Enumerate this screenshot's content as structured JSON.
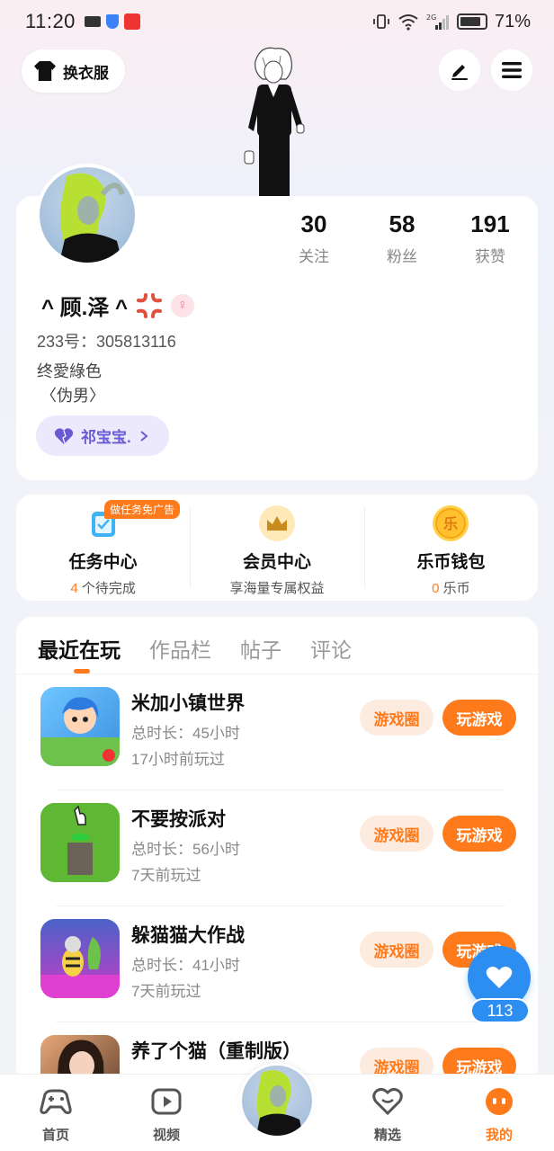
{
  "status_bar": {
    "time": "11:20",
    "battery": "71%",
    "network": "2G"
  },
  "top": {
    "outfit_label": "换衣服"
  },
  "profile": {
    "stats": [
      {
        "value": "30",
        "label": "关注"
      },
      {
        "value": "58",
        "label": "粉丝"
      },
      {
        "value": "191",
        "label": "获赞"
      }
    ],
    "username": "^ 顾.泽 ^",
    "uid": "233号：305813116",
    "bio_line1": "终愛綠色",
    "bio_line2": "〈伪男〉",
    "partner": "祁宝宝."
  },
  "services": [
    {
      "title": "任务中心",
      "count": "4",
      "sub": " 个待完成",
      "badge": "做任务免广告"
    },
    {
      "title": "会员中心",
      "sub": "享海量专属权益"
    },
    {
      "title": "乐币钱包",
      "count": "0",
      "sub": " 乐币"
    }
  ],
  "tabs": [
    "最近在玩",
    "作品栏",
    "帖子",
    "评论"
  ],
  "games": [
    {
      "name": "米加小镇世界",
      "duration": "总时长：45小时",
      "last": "17小时前玩过"
    },
    {
      "name": "不要按派对",
      "duration": "总时长：56小时",
      "last": "7天前玩过"
    },
    {
      "name": "躲猫猫大作战",
      "duration": "总时长：41小时",
      "last": "7天前玩过"
    },
    {
      "name": "养了个猫（重制版）",
      "duration": "",
      "last": ""
    }
  ],
  "game_buttons": {
    "circle": "游戏圈",
    "play": "玩游戏"
  },
  "float_like": {
    "count": "113"
  },
  "bottom_nav": [
    "首页",
    "视频",
    "精选",
    "我的"
  ],
  "colors": {
    "accent": "#ff7a1a",
    "blue": "#2b8ef0",
    "purple": "#6a5ad3"
  }
}
